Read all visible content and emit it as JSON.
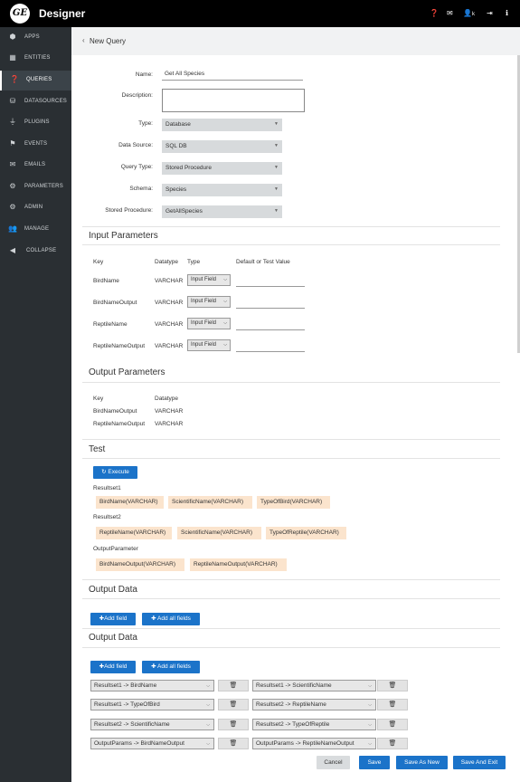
{
  "app": {
    "logo": "GE",
    "title": "Designer"
  },
  "topbar_icons": [
    "help-icon",
    "mail-icon",
    "user-icon",
    "logout-icon",
    "info-icon"
  ],
  "topbar_user_initial": "k",
  "sidebar": {
    "items": [
      {
        "label": "APPS",
        "icon": "apps-icon",
        "active": false
      },
      {
        "label": "ENTITIES",
        "icon": "table-icon",
        "active": false
      },
      {
        "label": "QUERIES",
        "icon": "question-icon",
        "active": true
      },
      {
        "label": "DATASOURCES",
        "icon": "database-icon",
        "active": false
      },
      {
        "label": "PLUGINS",
        "icon": "plug-icon",
        "active": false
      },
      {
        "label": "EVENTS",
        "icon": "flag-icon",
        "active": false
      },
      {
        "label": "EMAILS",
        "icon": "envelope-icon",
        "active": false
      },
      {
        "label": "PARAMETERS",
        "icon": "cogs-icon",
        "active": false
      },
      {
        "label": "ADMIN",
        "icon": "gear-icon",
        "active": false
      },
      {
        "label": "MANAGE",
        "icon": "users-icon",
        "active": false
      },
      {
        "label": "COLLAPSE",
        "icon": "chevron-left-icon",
        "active": false
      }
    ]
  },
  "breadcrumb": {
    "arrow": "‹",
    "label": "New Query"
  },
  "form": {
    "name_label": "Name:",
    "name_value": "Get All Species",
    "description_label": "Description:",
    "type_label": "Type:",
    "type_value": "Database",
    "datasource_label": "Data Source:",
    "datasource_value": "SQL DB",
    "querytype_label": "Query Type:",
    "querytype_value": "Stored Procedure",
    "schema_label": "Schema:",
    "schema_value": "Species",
    "procedure_label": "Stored Procedure:",
    "procedure_value": "GetAllSpecies"
  },
  "input_params": {
    "title": "Input Parameters",
    "headers": {
      "key": "Key",
      "datatype": "Datatype",
      "type": "Type",
      "value": "Default or Test Value"
    },
    "rows": [
      {
        "key": "BirdName",
        "datatype": "VARCHAR",
        "type": "Input Field"
      },
      {
        "key": "BirdNameOutput",
        "datatype": "VARCHAR",
        "type": "Input Field"
      },
      {
        "key": "ReptileName",
        "datatype": "VARCHAR",
        "type": "Input Field"
      },
      {
        "key": "ReptileNameOutput",
        "datatype": "VARCHAR",
        "type": "Input Field"
      }
    ]
  },
  "output_params": {
    "title": "Output Parameters",
    "headers": {
      "key": "Key",
      "datatype": "Datatype"
    },
    "rows": [
      {
        "key": "BirdNameOutput",
        "datatype": "VARCHAR"
      },
      {
        "key": "ReptileNameOutput",
        "datatype": "VARCHAR"
      }
    ]
  },
  "test": {
    "title": "Test",
    "execute_label": "Execute",
    "resultset1_label": "Resultset1",
    "resultset1": [
      "BirdName(VARCHAR)",
      "ScientificName(VARCHAR)",
      "TypeOfBird(VARCHAR)"
    ],
    "resultset2_label": "Resultset2",
    "resultset2": [
      "ReptileName(VARCHAR)",
      "ScientificName(VARCHAR)",
      "TypeOfReptile(VARCHAR)"
    ],
    "outputparam_label": "OutputParameter",
    "outputparam": [
      "BirdNameOutput(VARCHAR)",
      "ReptileNameOutput(VARCHAR)"
    ]
  },
  "output_data_1": {
    "title": "Output Data",
    "add_field": "Add field",
    "add_all": "Add all fields"
  },
  "output_data_2": {
    "title": "Output Data",
    "add_field": "Add field",
    "add_all": "Add all fields",
    "mappings": [
      "Resultset1 -> BirdName",
      "Resultset1 -> ScientificName",
      "Resultset1 -> TypeOfBird",
      "Resultset2 -> ReptileName",
      "Resultset2 -> ScientificName",
      "Resultset2 -> TypeOfReptile",
      "OutputParams -> BirdNameOutput",
      "OutputParams -> ReptileNameOutput"
    ]
  },
  "footer": {
    "cancel": "Cancel",
    "save": "Save",
    "save_as_new": "Save As New",
    "save_and_exit": "Save And Exit"
  },
  "colors": {
    "primary": "#1b73c9",
    "sidebar": "#2a2f33",
    "chip": "#fbe4cd"
  }
}
